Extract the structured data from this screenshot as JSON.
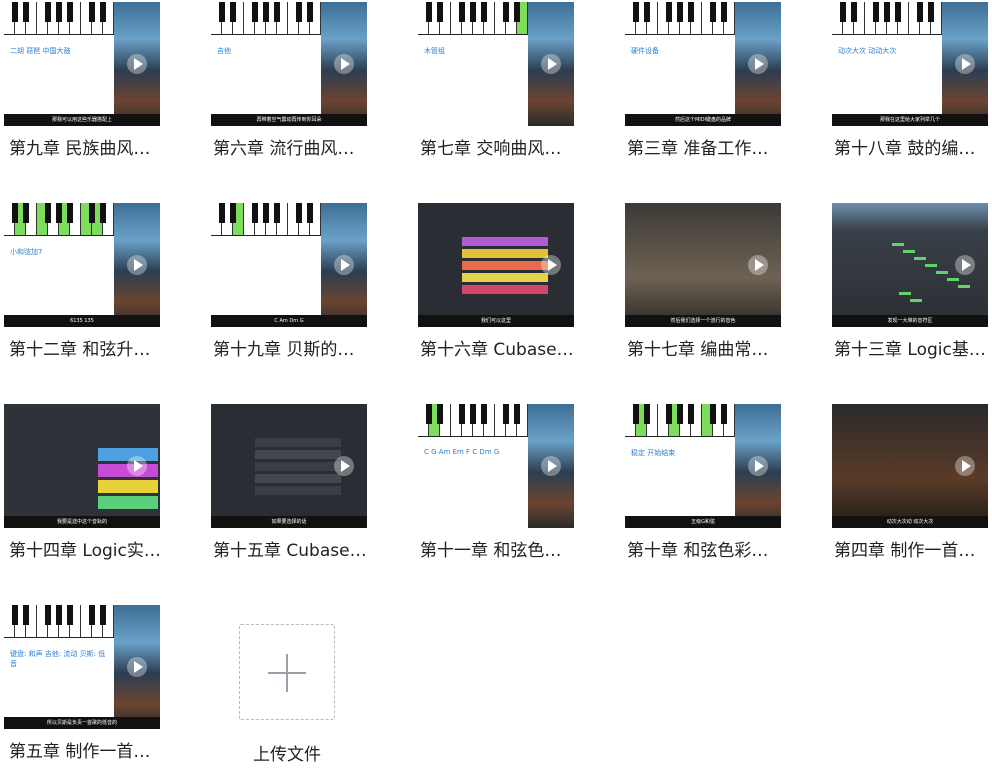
{
  "files": [
    {
      "title": "第九章 民族曲风…",
      "subtitle": "那我可以用这些乐器搭配上",
      "inner": "二胡  琵琶  中国大鼓",
      "style": "piano",
      "lit": []
    },
    {
      "title": "第六章 流行曲风…",
      "subtitle": "再带着空气震动再传到你耳朵",
      "inner": "吉他",
      "style": "piano",
      "lit": []
    },
    {
      "title": "第七章 交响曲风…",
      "subtitle": "",
      "inner": "木管组",
      "style": "piano",
      "lit": [
        9
      ]
    },
    {
      "title": "第三章 准备工作…",
      "subtitle": "然后这个MIDI键盘的品牌",
      "inner": "硬件设备",
      "style": "piano",
      "lit": []
    },
    {
      "title": "第十八章 鼓的编…",
      "subtitle": "那我在这里给大家列举几个",
      "inner": "动次大次 动动大次",
      "style": "piano",
      "lit": []
    },
    {
      "title": "第十二章 和弦升…",
      "subtitle": "6135 135",
      "inner": "小和弦加7",
      "style": "piano",
      "lit": [
        1,
        3,
        5,
        7,
        8
      ]
    },
    {
      "title": "第十九章 贝斯的…",
      "subtitle": "C   Am   Dm   G",
      "inner": "",
      "style": "piano",
      "lit": [
        2
      ]
    },
    {
      "title": "第十六章 Cubase…",
      "subtitle": "我们可以这里",
      "inner": "",
      "style": "daw",
      "lit": []
    },
    {
      "title": "第十七章 编曲常…",
      "subtitle": "然后我们选择一个流行的音色",
      "inner": "",
      "style": "drums",
      "lit": []
    },
    {
      "title": "第十三章 Logic基…",
      "subtitle": "发现一大堆的音符区",
      "inner": "",
      "style": "logic",
      "lit": []
    },
    {
      "title": "第十四章 Logic实…",
      "subtitle": "我要是选中这个音轨的",
      "inner": "",
      "style": "logic2",
      "lit": []
    },
    {
      "title": "第十五章 Cubase…",
      "subtitle": "如果要选择的话",
      "inner": "",
      "style": "daw2",
      "lit": []
    },
    {
      "title": "第十一章 和弦色…",
      "subtitle": "",
      "inner": "C G Am Em F C Dm G",
      "style": "piano",
      "lit": [
        1
      ]
    },
    {
      "title": "第十章 和弦色彩…",
      "subtitle": "五级G和弦",
      "inner": "稳定  开始结束",
      "style": "piano",
      "lit": [
        1,
        4,
        7
      ]
    },
    {
      "title": "第四章 制作一首…",
      "subtitle": "动次大次动 动次大次",
      "inner": "",
      "style": "drums2",
      "lit": []
    },
    {
      "title": "第五章 制作一首…",
      "subtitle": "所以贝斯是负责一首歌的低音的",
      "inner": "键盘: 和声  吉他: 流动  贝斯: 低音",
      "style": "piano",
      "lit": []
    }
  ],
  "upload": {
    "label": "上传文件",
    "icon": "plus-icon"
  },
  "colors": {
    "key_highlight": "#7fdc5a",
    "caption": "#222222",
    "upload_border": "#b8bcc2"
  }
}
